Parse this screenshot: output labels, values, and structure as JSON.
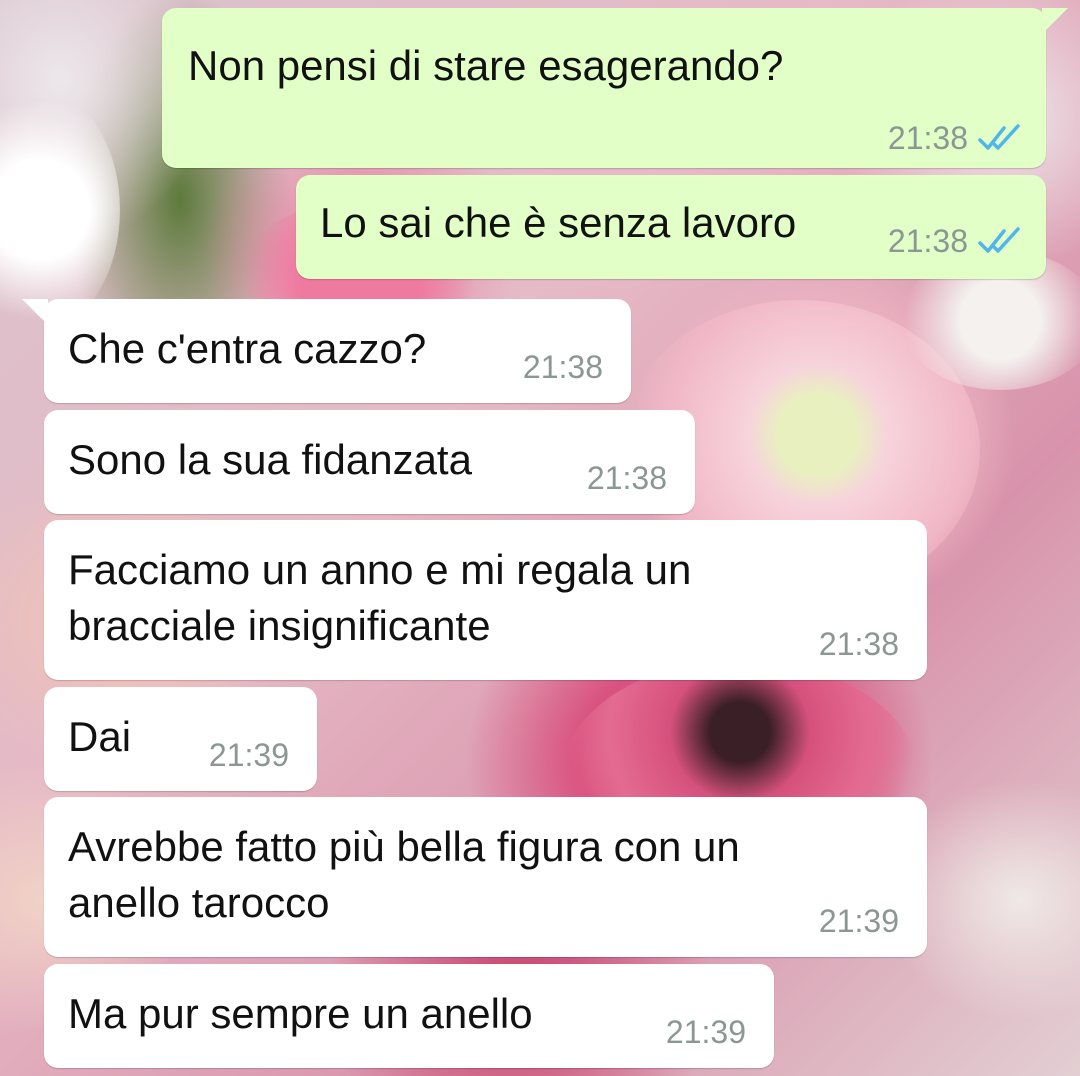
{
  "messages": [
    {
      "direction": "out",
      "text": "Non pensi di stare esagerando?",
      "time": "21:38",
      "status_icon": "double-check-read-icon"
    },
    {
      "direction": "out",
      "text": "Lo sai che è senza lavoro",
      "time": "21:38",
      "status_icon": "double-check-read-icon"
    },
    {
      "direction": "in",
      "text": "Che c'entra cazzo?",
      "time": "21:38"
    },
    {
      "direction": "in",
      "text": "Sono la sua fidanzata",
      "time": "21:38"
    },
    {
      "direction": "in",
      "text": "Facciamo un anno e mi regala un\nbracciale insignificante",
      "time": "21:38"
    },
    {
      "direction": "in",
      "text": "Dai",
      "time": "21:39"
    },
    {
      "direction": "in",
      "text": "Avrebbe fatto più bella figura con un\nanello tarocco",
      "time": "21:39"
    },
    {
      "direction": "in",
      "text": "Ma pur sempre un anello",
      "time": "21:39"
    }
  ],
  "colors": {
    "outgoing_bubble": "#e2ffc7",
    "incoming_bubble": "#ffffff",
    "timestamp": "#8c9794",
    "read_ticks": "#4fb6ec"
  }
}
